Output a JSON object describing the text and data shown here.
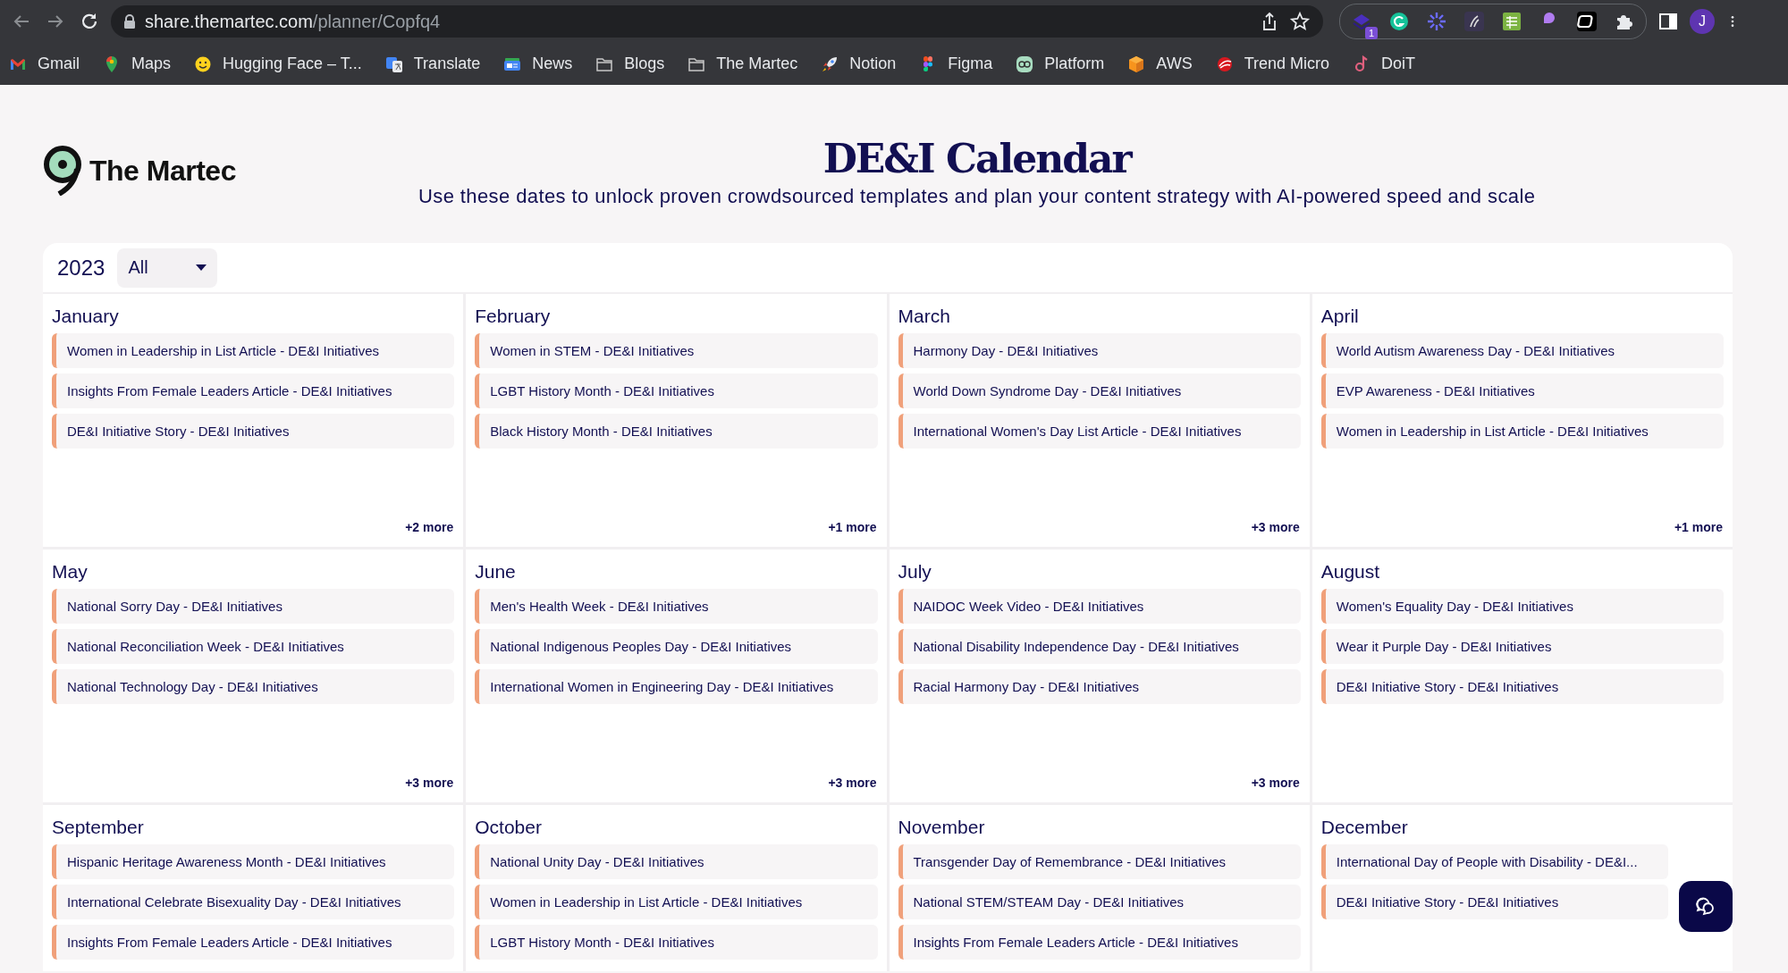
{
  "browser": {
    "url_host": "share.themartec.com",
    "url_path": "/planner/Copfq4",
    "extension_badge": "1",
    "profile_initial": "J",
    "bookmarks": [
      {
        "label": "Gmail",
        "kind": "mail"
      },
      {
        "label": "Maps",
        "kind": "pin"
      },
      {
        "label": "Hugging Face – T...",
        "kind": "smiley"
      },
      {
        "label": "Translate",
        "kind": "translate"
      },
      {
        "label": "News",
        "kind": "news"
      },
      {
        "label": "Blogs",
        "kind": "folder"
      },
      {
        "label": "The Martec",
        "kind": "folder"
      },
      {
        "label": "Notion",
        "kind": "rocket"
      },
      {
        "label": "Figma",
        "kind": "circles"
      },
      {
        "label": "Platform",
        "kind": "glasses"
      },
      {
        "label": "AWS",
        "kind": "cube"
      },
      {
        "label": "Trend Micro",
        "kind": "swirl"
      },
      {
        "label": "DoiT",
        "kind": "note"
      }
    ]
  },
  "brand": {
    "name": "The Martec"
  },
  "title": "DE&I Calendar",
  "subtitle": "Use these dates to unlock proven crowdsourced templates and plan your content strategy with AI-powered speed and scale",
  "filter": {
    "year": "2023",
    "category": "All"
  },
  "months": [
    {
      "name": "January",
      "events": [
        "Women in Leadership in List Article - DE&I Initiatives",
        "Insights From Female Leaders Article - DE&I Initiatives",
        "DE&I Initiative Story - DE&I Initiatives"
      ],
      "more": "+2 more"
    },
    {
      "name": "February",
      "events": [
        "Women in STEM - DE&I Initiatives",
        "LGBT History Month - DE&I Initiatives",
        "Black History Month - DE&I Initiatives"
      ],
      "more": "+1 more"
    },
    {
      "name": "March",
      "events": [
        "Harmony Day - DE&I Initiatives",
        "World Down Syndrome Day - DE&I Initiatives",
        "International Women's Day List Article - DE&I Initiatives"
      ],
      "more": "+3 more"
    },
    {
      "name": "April",
      "events": [
        "World Autism Awareness Day - DE&I Initiatives",
        "EVP Awareness - DE&I Initiatives",
        "Women in Leadership in List Article - DE&I Initiatives"
      ],
      "more": "+1 more"
    },
    {
      "name": "May",
      "events": [
        "National Sorry Day - DE&I Initiatives",
        "National Reconciliation Week - DE&I Initiatives",
        "National Technology Day - DE&I Initiatives"
      ],
      "more": "+3 more"
    },
    {
      "name": "June",
      "events": [
        "Men's Health Week - DE&I Initiatives",
        "National Indigenous Peoples Day - DE&I Initiatives",
        "International Women in Engineering Day - DE&I Initiatives"
      ],
      "more": "+3 more"
    },
    {
      "name": "July",
      "events": [
        "NAIDOC Week Video - DE&I Initiatives",
        "National Disability Independence Day - DE&I Initiatives",
        "Racial Harmony Day - DE&I Initiatives"
      ],
      "more": "+3 more"
    },
    {
      "name": "August",
      "events": [
        "Women's Equality Day - DE&I Initiatives",
        "Wear it Purple Day - DE&I Initiatives",
        "DE&I Initiative Story - DE&I Initiatives"
      ]
    },
    {
      "name": "September",
      "events": [
        "Hispanic Heritage Awareness Month - DE&I Initiatives",
        "International Celebrate Bisexuality Day - DE&I Initiatives",
        "Insights From Female Leaders Article - DE&I Initiatives"
      ]
    },
    {
      "name": "October",
      "events": [
        "National Unity Day - DE&I Initiatives",
        "Women in Leadership in List Article - DE&I Initiatives",
        "LGBT History Month - DE&I Initiatives"
      ]
    },
    {
      "name": "November",
      "events": [
        "Transgender Day of Remembrance - DE&I Initiatives",
        "National STEM/STEAM Day - DE&I Initiatives",
        "Insights From Female Leaders Article - DE&I Initiatives"
      ]
    },
    {
      "name": "December",
      "events": [
        "International Day of People with Disability - DE&I...",
        "DE&I Initiative Story - DE&I Initiatives"
      ]
    }
  ]
}
